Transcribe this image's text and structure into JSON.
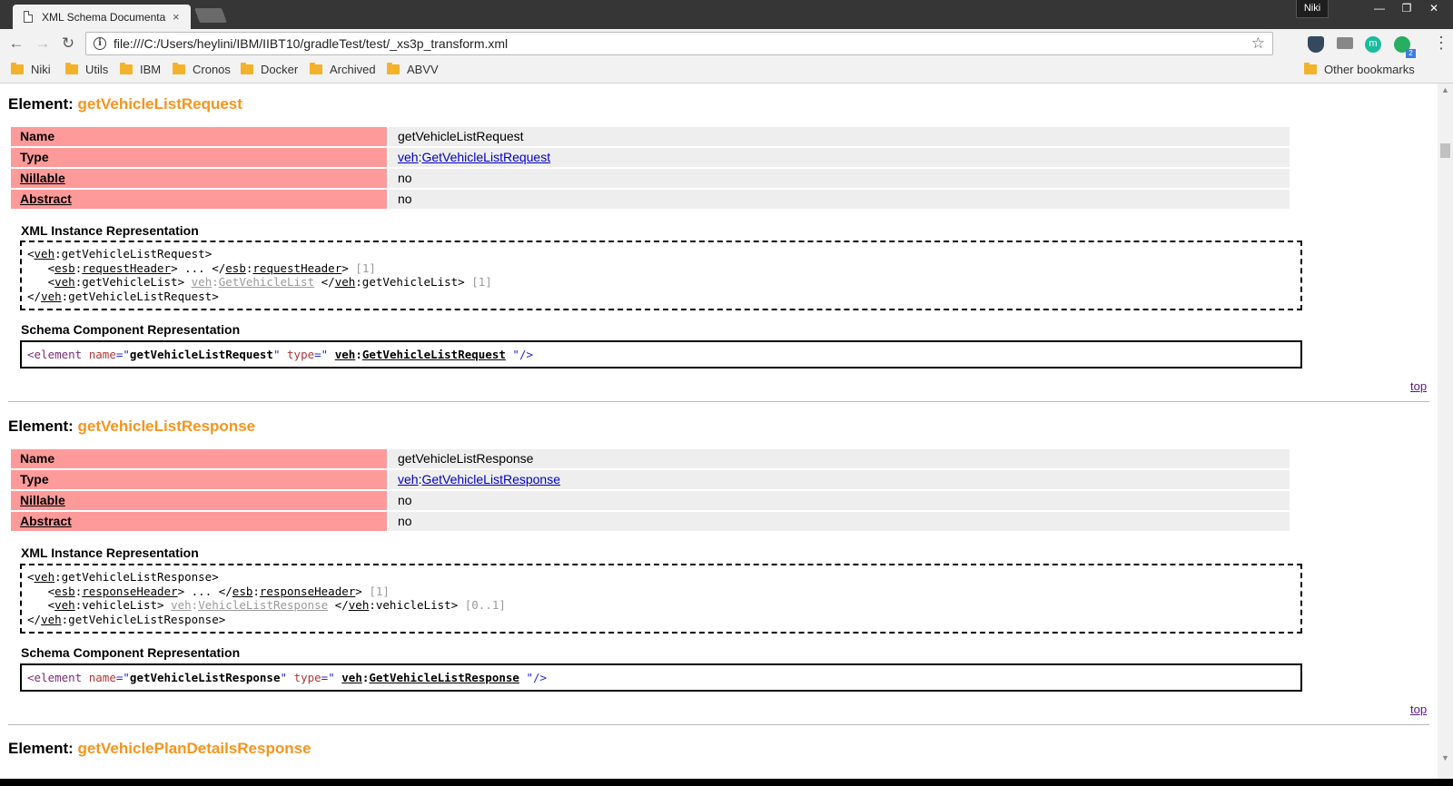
{
  "browser": {
    "tab_title": "XML Schema Documenta",
    "tab_close": "×",
    "profile": "Niki",
    "win_minimize": "—",
    "win_restore": "❐",
    "win_close": "✕",
    "url": "file:///C:/Users/heylini/IBM/IIBT10/gradleTest/test/_xs3p_transform.xml",
    "ext_m_label": "m",
    "ext_badge": "2",
    "bookmarks": [
      "Niki",
      "Utils",
      "IBM",
      "Cronos",
      "Docker",
      "Archived",
      "ABVV"
    ],
    "other_bookmarks": "Other bookmarks"
  },
  "labels": {
    "element_prefix": "Element:",
    "name": "Name",
    "type": "Type",
    "nillable": "Nillable",
    "abstract": "Abstract",
    "xml_instance": "XML Instance Representation",
    "schema_component": "Schema Component Representation",
    "top": "top"
  },
  "elements": [
    {
      "name": "getVehicleListRequest",
      "type_prefix": "veh",
      "type_name": "GetVehicleListRequest",
      "nillable": "no",
      "abstract": "no",
      "xml": {
        "root_prefix": "veh",
        "root_name": "getVehicleListRequest",
        "line2_prefix": "esb",
        "line2_name": "requestHeader",
        "line2_content": "...",
        "line2_card": "[1]",
        "line3_prefix": "veh",
        "line3_name": "getVehicleList",
        "line3_type_prefix": "veh",
        "line3_type_name": "GetVehicleList",
        "line3_card": "[1]"
      },
      "schema": {
        "keyword": "element",
        "name_attr": "name",
        "name_value": "getVehicleListRequest",
        "type_attr": "type",
        "type_prefix": "veh",
        "type_name": "GetVehicleListRequest"
      }
    },
    {
      "name": "getVehicleListResponse",
      "type_prefix": "veh",
      "type_name": "GetVehicleListResponse",
      "nillable": "no",
      "abstract": "no",
      "xml": {
        "root_prefix": "veh",
        "root_name": "getVehicleListResponse",
        "line2_prefix": "esb",
        "line2_name": "responseHeader",
        "line2_content": "...",
        "line2_card": "[1]",
        "line3_prefix": "veh",
        "line3_name": "vehicleList",
        "line3_type_prefix": "veh",
        "line3_type_name": "VehicleListResponse",
        "line3_card": "[0..1]"
      },
      "schema": {
        "keyword": "element",
        "name_attr": "name",
        "name_value": "getVehicleListResponse",
        "type_attr": "type",
        "type_prefix": "veh",
        "type_name": "GetVehicleListResponse"
      }
    },
    {
      "name": "getVehiclePlanDetailsResponse"
    }
  ]
}
